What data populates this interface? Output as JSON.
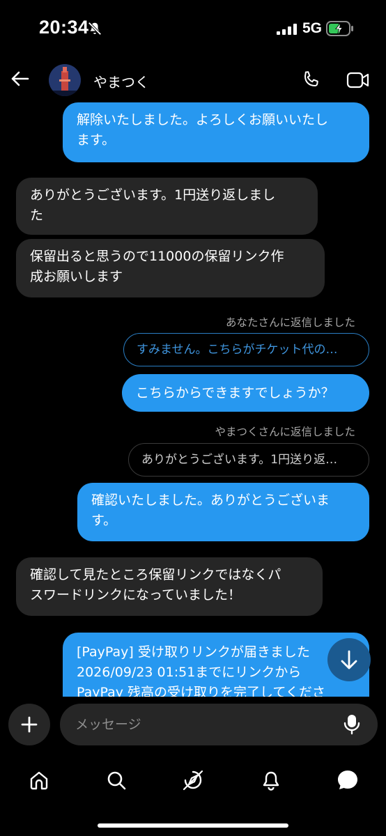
{
  "status": {
    "time": "20:34",
    "network": "5G",
    "battery_level": 0.6
  },
  "header": {
    "name": "やまつく"
  },
  "messages": {
    "m1": "解除いたしました。よろしくお願いいたし\nます。",
    "m2": "ありがとうございます。1円送り返しまし\nた",
    "m3": "保留出ると思うので11000の保留リンク作\n成お願いします",
    "reply1_label": "あなたさんに返信しました",
    "reply1_quote": "すみません。こちらがチケット代の…",
    "m4": "こちらからできますでしょうか？",
    "reply2_label": "やまつくさんに返信しました",
    "reply2_quote": "ありがとうございます。1円送り返…",
    "m5": "確認いたしました。ありがとうございま\nす。",
    "m6": "確認して見たところ保留リンクではなくパ\nスワードリンクになっていました！",
    "m7": "[PayPay] 受け取りリンクが届きました\n2026/09/23 01:51までにリンクから\nPayPay 残高の受け取りを完了してくださ"
  },
  "composer": {
    "placeholder": "メッセージ"
  },
  "icons": {
    "bell_off": "bell-slash-icon",
    "back": "arrow-left-icon",
    "call": "phone-icon",
    "video": "video-camera-icon",
    "scroll_down": "arrow-down-icon",
    "plus": "plus-icon",
    "mic": "microphone-icon",
    "nav": [
      "home-icon",
      "search-icon",
      "explore-compass-icon",
      "notifications-bell-icon",
      "messages-bubble-icon"
    ]
  },
  "colors": {
    "sent_bubble": "#2798f0",
    "received_bubble": "#262626",
    "background": "#000000",
    "battery_charging": "#34c759"
  }
}
